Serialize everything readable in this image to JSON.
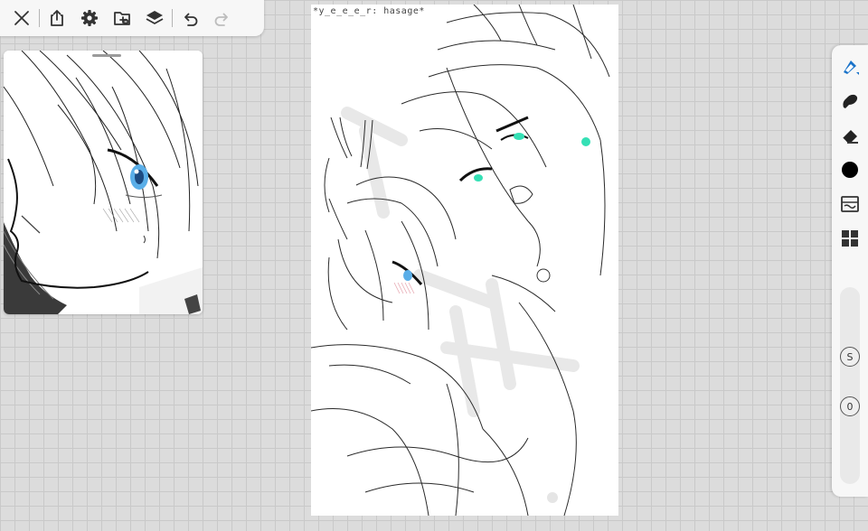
{
  "toolbar": {
    "icons": [
      "close-icon",
      "share-icon",
      "gear-icon",
      "gallery-icon",
      "layers-icon",
      "undo-icon",
      "redo-icon"
    ]
  },
  "canvas": {
    "signature_text": "*y_e_e_e_r: hasage*"
  },
  "right_toolbar": {
    "icons": [
      "brush-icon",
      "smudge-icon",
      "eraser-icon",
      "color-swatch",
      "filter-icon",
      "apps-icon"
    ],
    "current_color": "#000000",
    "size_label": "S",
    "opacity_label": "0"
  },
  "colors": {
    "accent": "#1a73c9",
    "eye_teal": "#35e0b5",
    "eye_blue": "#5aaee8",
    "background": "#dcdcdc"
  }
}
